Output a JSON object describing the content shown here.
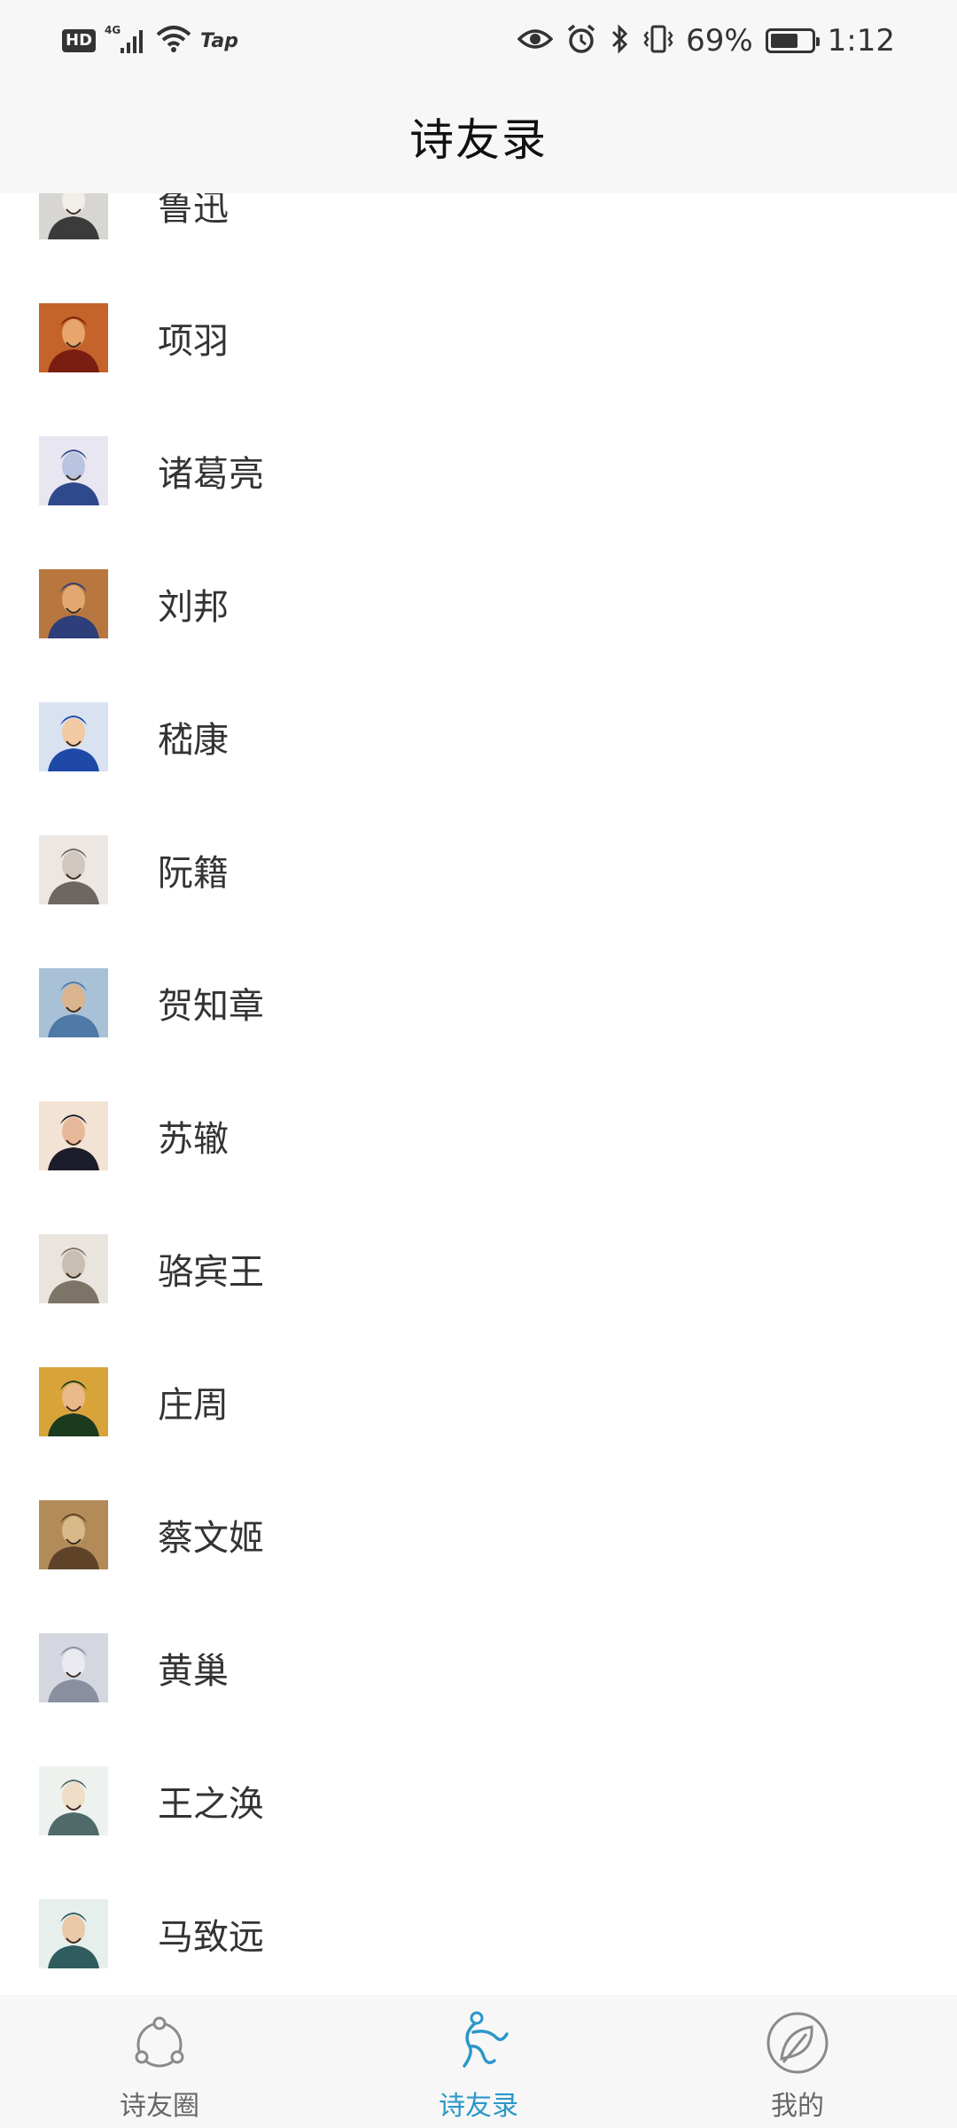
{
  "status_bar": {
    "hd": "HD",
    "network": "4G",
    "wifi_extra": "Tap",
    "battery_text": "69%",
    "battery_level": 0.69,
    "time": "1:12"
  },
  "header": {
    "title": "诗友录"
  },
  "contacts": [
    {
      "name": "鲁迅",
      "avatar_icon": "portrait-luxun"
    },
    {
      "name": "项羽",
      "avatar_icon": "portrait-xiangyu"
    },
    {
      "name": "诸葛亮",
      "avatar_icon": "portrait-zhugeliang"
    },
    {
      "name": "刘邦",
      "avatar_icon": "portrait-liubang"
    },
    {
      "name": "嵇康",
      "avatar_icon": "portrait-jikang"
    },
    {
      "name": "阮籍",
      "avatar_icon": "portrait-ruanji"
    },
    {
      "name": "贺知章",
      "avatar_icon": "portrait-hezhizhang"
    },
    {
      "name": "苏辙",
      "avatar_icon": "portrait-suzhe"
    },
    {
      "name": "骆宾王",
      "avatar_icon": "portrait-luobinwang"
    },
    {
      "name": "庄周",
      "avatar_icon": "portrait-zhuangzhou"
    },
    {
      "name": "蔡文姬",
      "avatar_icon": "portrait-caiwenji"
    },
    {
      "name": "黄巢",
      "avatar_icon": "portrait-huangchao"
    },
    {
      "name": "王之涣",
      "avatar_icon": "portrait-wangzhihuan"
    },
    {
      "name": "马致远",
      "avatar_icon": "portrait-mazhiyuan"
    }
  ],
  "bottom_nav": {
    "items": [
      {
        "label": "诗友圈",
        "icon": "circle-dots-icon",
        "active": false
      },
      {
        "label": "诗友录",
        "icon": "dancing-figure-icon",
        "active": true
      },
      {
        "label": "我的",
        "icon": "leaf-circle-icon",
        "active": false
      }
    ]
  },
  "colors": {
    "accent": "#2a97c9",
    "bar_bg": "#f7f7f7"
  }
}
